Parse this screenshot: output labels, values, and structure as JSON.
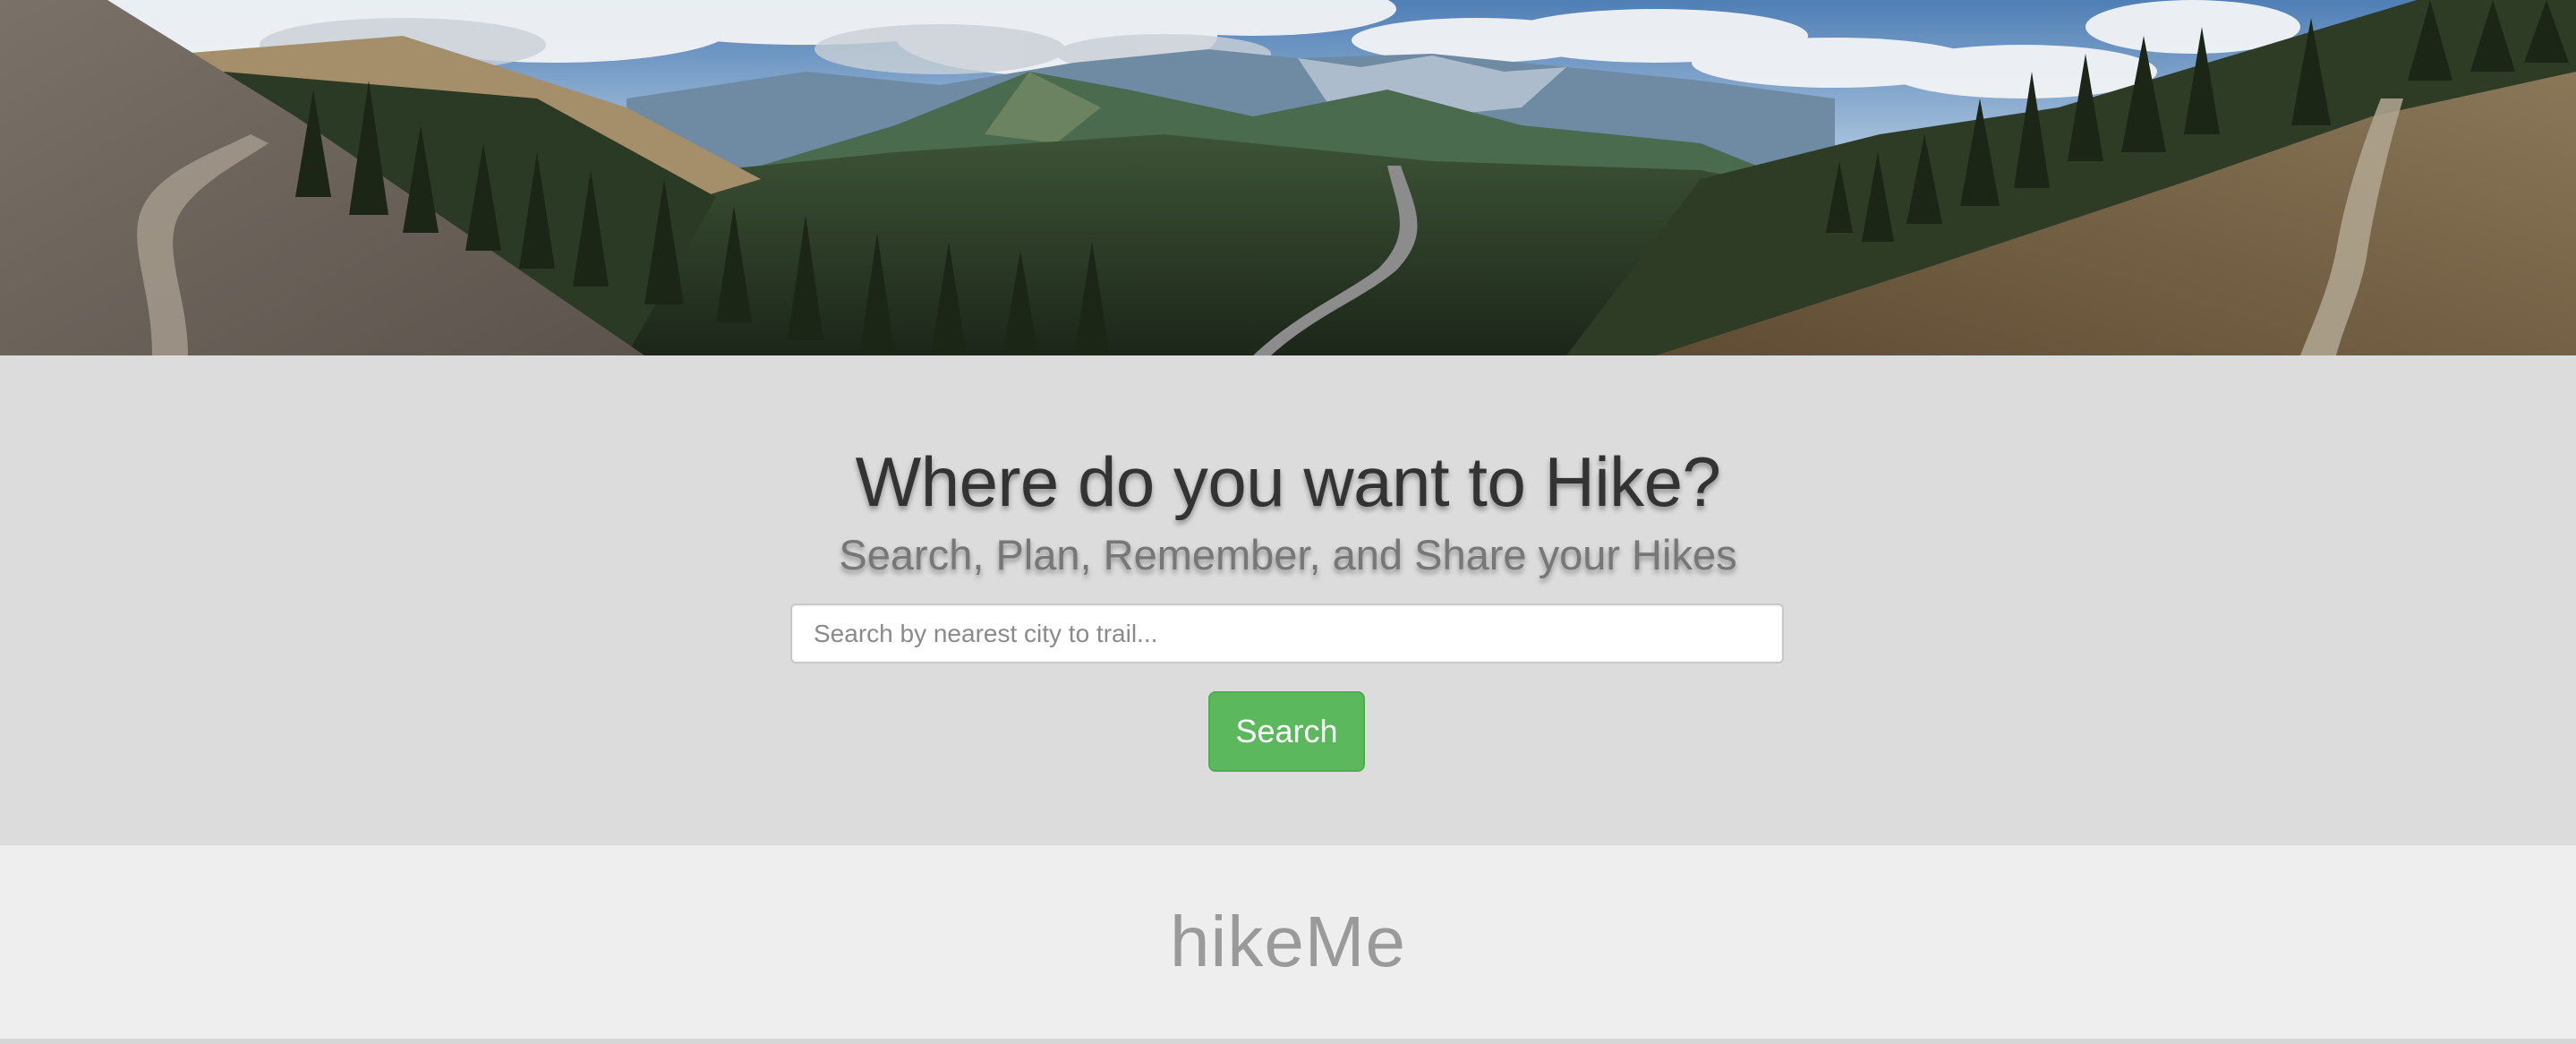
{
  "hero": {
    "image": "mountain-panorama",
    "colors": {
      "sky_top": "#4f7fb6",
      "sky_bottom": "#a9c4de",
      "cloud": "#f2f4f6",
      "distant_range": "#6f8aa3",
      "forest_dark": "#1f2a1c",
      "forest_mid": "#2f3f27",
      "slope_left": "#6b625a",
      "slope_right": "#6f5a3f",
      "trail": "#a39a8c",
      "road": "#8c8c8c"
    }
  },
  "search_section": {
    "headline": "Where do you want to Hike?",
    "subheadline": "Search, Plan, Remember, and Share your Hikes",
    "search_placeholder": "Search by nearest city to trail...",
    "search_value": "",
    "search_button_label": "Search",
    "background": "#dcdcdc",
    "button_color": "#5cb85c"
  },
  "footer": {
    "brand": "hikeMe",
    "background": "#eeeeee"
  }
}
